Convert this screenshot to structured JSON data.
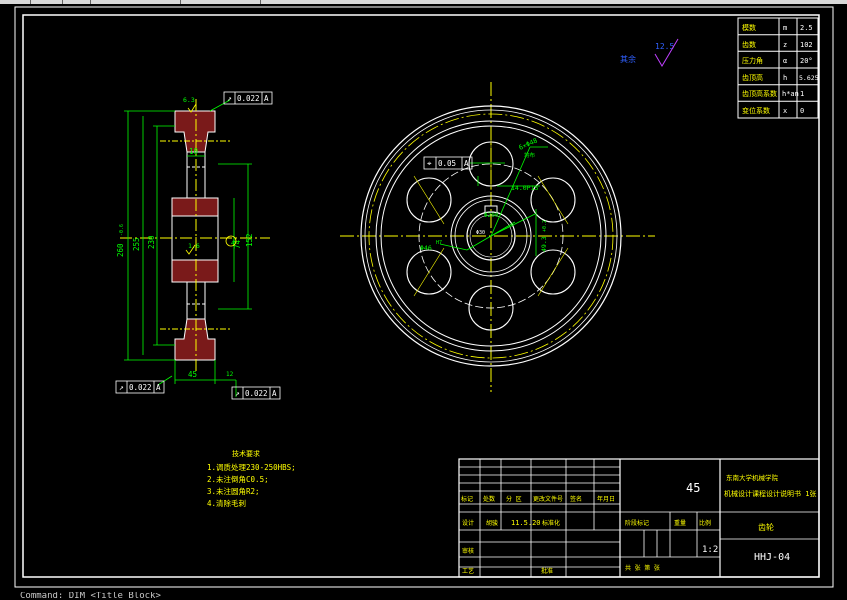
{
  "window": {
    "status_text": "Command: DIM  <Title Block>"
  },
  "colors": {
    "background": "#000000",
    "border": "#ffffff",
    "dimension": "#00ff00",
    "centerline": "#ffff00",
    "section_fill": "#7a1a1a",
    "outline": "#ffffff",
    "annotation": "#ffff00",
    "roughness_mark": "#3060ff"
  },
  "gear_table": {
    "rows": [
      {
        "param": "模数",
        "symbol": "m",
        "value": "2.5"
      },
      {
        "param": "齿数",
        "symbol": "z",
        "value": "102"
      },
      {
        "param": "压力角",
        "symbol": "α",
        "value": "20°"
      },
      {
        "param": "齿顶高",
        "symbol": "h",
        "value": "5.625"
      },
      {
        "param": "齿顶高系数",
        "symbol": "h*an",
        "value": "1"
      },
      {
        "param": "变位系数",
        "symbol": "x",
        "value": "0"
      }
    ]
  },
  "roughness_note": {
    "label": "其余",
    "value": "12.5"
  },
  "section_view": {
    "dims": {
      "d1": "260",
      "d1_tol": "-0.6",
      "d2": "255",
      "d3": "230",
      "hub_bore": "74",
      "d5": "152",
      "web": "10",
      "width": "45",
      "chamfer": "12",
      "bore_rough": "1.6",
      "tip_rough": "6.3",
      "mark": "4"
    },
    "tolerance_frames": [
      {
        "symbol": "↗",
        "value": "0.022",
        "datum": "A"
      },
      {
        "symbol": "↗",
        "value": "0.022",
        "datum": "A"
      },
      {
        "symbol": "↗",
        "value": "0.022",
        "datum": "A"
      }
    ]
  },
  "front_view": {
    "hole_dim": "6×Φ48",
    "hole_dim_sub": "均布",
    "position_frame": {
      "symbol": "⌖",
      "value": "0.05",
      "datum": "A"
    },
    "keyway_dim": "14.0P15",
    "bore_dim": "Φ46",
    "bore_tol": "H7",
    "key_depth": "49.3",
    "key_depth_tol": "+0.2",
    "pcd_dim": "Φ200",
    "bore_text": "Φ30"
  },
  "tech_requirements": {
    "title": "技术要求",
    "items": [
      "1.调质处理230-250HBS;",
      "2.未注倒角C0.5;",
      "3.未注圆角R2;",
      "4.清除毛刺"
    ]
  },
  "title_block": {
    "material": "45",
    "school": "东南大学机械学院",
    "project": "机械设计课程设计说明书 1张",
    "part_name": "齿轮",
    "drawing_no": "HHJ-04",
    "scale": "1:2",
    "label_mark": "标记",
    "label_count": "处数",
    "label_zone": "分  区",
    "label_change_no": "更改文件号",
    "label_sign": "签名",
    "label_date": "年月日",
    "label_design": "设计",
    "label_std": "标准化",
    "label_audit": "审核",
    "label_process": "工艺",
    "label_approve": "批准",
    "label_stage": "阶段标记",
    "label_weight": "重量",
    "label_ratio": "比例",
    "label_sheets": "共  张  第  张",
    "design_date": "11.5.20",
    "designer": "胡骏"
  }
}
